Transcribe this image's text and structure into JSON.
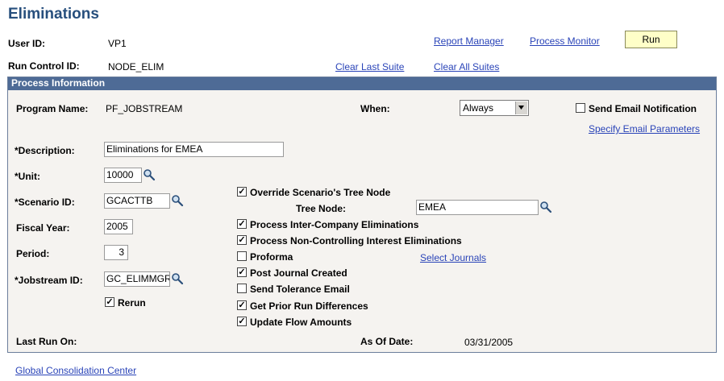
{
  "page": {
    "title": "Eliminations"
  },
  "header": {
    "user_id_label": "User ID:",
    "user_id_value": "VP1",
    "run_control_label": "Run Control ID:",
    "run_control_value": "NODE_ELIM",
    "report_manager": "Report Manager",
    "process_monitor": "Process Monitor",
    "run_button": "Run",
    "clear_last_suite": "Clear Last Suite",
    "clear_all_suites": "Clear All Suites"
  },
  "panel": {
    "title": "Process Information",
    "program_name_label": "Program Name:",
    "program_name_value": "PF_JOBSTREAM",
    "when_label": "When:",
    "when_value": "Always",
    "send_email_label": "Send Email Notification",
    "send_email_checked": false,
    "specify_email_params": "Specify Email Parameters",
    "description_label": "*Description:",
    "description_value": "Eliminations for EMEA",
    "unit_label": "*Unit:",
    "unit_value": "10000",
    "scenario_label": "*Scenario ID:",
    "scenario_value": "GCACTTB",
    "fiscal_year_label": "Fiscal Year:",
    "fiscal_year_value": "2005",
    "period_label": "Period:",
    "period_value": "3",
    "jobstream_label": "*Jobstream ID:",
    "jobstream_value": "GC_ELIMMGR",
    "rerun_label": "Rerun",
    "rerun_checked": true,
    "tree_node_label": "Tree Node:",
    "tree_node_value": "EMEA",
    "select_journals": "Select Journals",
    "last_run_label": "Last Run On:",
    "as_of_date_label": "As Of Date:",
    "as_of_date_value": "03/31/2005",
    "options": [
      {
        "label": "Override Scenario's Tree Node",
        "checked": true
      },
      {
        "label": "Process Inter-Company Eliminations",
        "checked": true
      },
      {
        "label": "Process Non-Controlling Interest Eliminations",
        "checked": true
      },
      {
        "label": "Proforma",
        "checked": false
      },
      {
        "label": "Post Journal Created",
        "checked": true
      },
      {
        "label": "Send Tolerance Email",
        "checked": false
      },
      {
        "label": "Get Prior Run Differences",
        "checked": true
      },
      {
        "label": "Update Flow Amounts",
        "checked": true
      }
    ]
  },
  "footer": {
    "global_consolidation_center": "Global Consolidation Center"
  }
}
